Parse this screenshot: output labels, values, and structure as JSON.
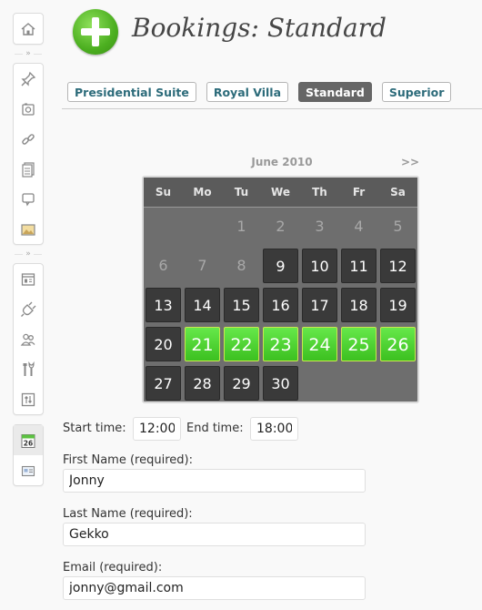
{
  "sidebar": {
    "icons": [
      "dashboard-icon",
      "pin-icon",
      "media-icon",
      "link-icon",
      "pages-icon",
      "comments-icon",
      "gallery-icon",
      "appearance-icon",
      "plugins-icon",
      "users-icon",
      "tools-icon",
      "settings-icon",
      "calendar-icon",
      "bookings-icon"
    ],
    "calendar_day": "26",
    "collapse_glyph": "»"
  },
  "header": {
    "title": "Bookings: Standard"
  },
  "tabs": [
    {
      "label": "Presidential Suite",
      "active": false
    },
    {
      "label": "Royal Villa",
      "active": false
    },
    {
      "label": "Standard",
      "active": true
    },
    {
      "label": "Superior",
      "active": false
    }
  ],
  "calendar": {
    "month": "June 2010",
    "next": ">>",
    "days": [
      "Su",
      "Mo",
      "Tu",
      "We",
      "Th",
      "Fr",
      "Sa"
    ],
    "cells": [
      [
        "",
        "",
        "1",
        "2",
        "3",
        "4",
        "5"
      ],
      [
        "6",
        "7",
        "8",
        "9",
        "10",
        "11",
        "12"
      ],
      [
        "13",
        "14",
        "15",
        "16",
        "17",
        "18",
        "19"
      ],
      [
        "20",
        "21",
        "22",
        "23",
        "24",
        "25",
        "26"
      ],
      [
        "27",
        "28",
        "29",
        "30",
        "",
        "",
        ""
      ]
    ],
    "states": [
      [
        "empty",
        "empty",
        "muted",
        "muted",
        "muted",
        "muted",
        "muted"
      ],
      [
        "muted",
        "muted",
        "muted",
        "avail",
        "avail",
        "avail",
        "avail"
      ],
      [
        "avail",
        "avail",
        "avail",
        "avail",
        "avail",
        "avail",
        "avail"
      ],
      [
        "avail",
        "booked",
        "booked",
        "booked",
        "booked",
        "booked",
        "booked"
      ],
      [
        "avail",
        "avail",
        "avail",
        "avail",
        "empty",
        "empty",
        "empty"
      ]
    ]
  },
  "form": {
    "start_label": "Start time:",
    "start_value": "12:00",
    "end_label": "End time:",
    "end_value": "18:00",
    "first_label": "First Name (required):",
    "first_value": "Jonny",
    "last_label": "Last Name (required):",
    "last_value": "Gekko",
    "email_label": "Email (required):",
    "email_value": "jonny@gmail.com"
  }
}
